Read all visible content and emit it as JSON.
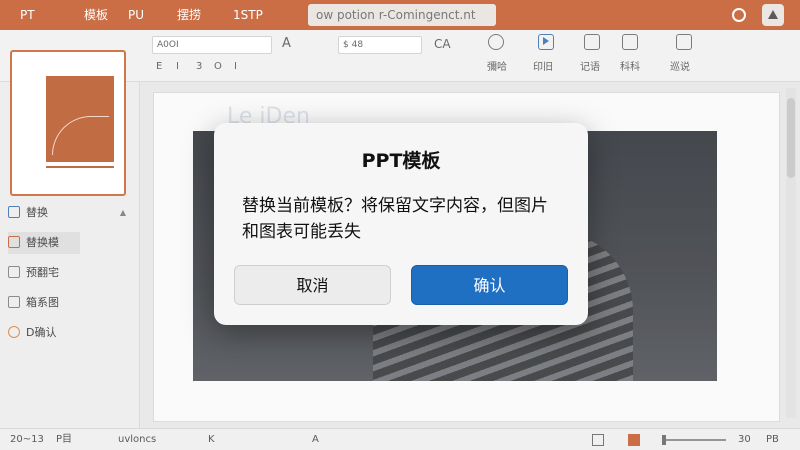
{
  "titlebar": {
    "app_label": "PT",
    "menu": [
      "模板",
      "PU",
      "摆捞",
      "1STP"
    ],
    "filename": "ow potion r-Comingenct.nt"
  },
  "ribbon": {
    "font_name": "A0OI",
    "font_size": "$ 48",
    "row1_labels": [
      "A",
      "CA"
    ],
    "row2_labels": [
      "E",
      "I",
      "3",
      "O",
      "I"
    ],
    "group_labels": [
      "彌哈",
      "印旧",
      "记语",
      "科科",
      "巡说"
    ]
  },
  "sidebar": {
    "items": [
      {
        "label": "替换",
        "icon": "layout-icon"
      },
      {
        "label": "替换模",
        "icon": "template-icon"
      },
      {
        "label": "预翻宅",
        "icon": "document-icon"
      },
      {
        "label": "箱系图",
        "icon": "chart-icon"
      },
      {
        "label": "D确认",
        "icon": "colors-icon"
      }
    ]
  },
  "slide": {
    "title_text": "Le iDen"
  },
  "statusbar": {
    "slide_count": "20~13",
    "view_label": "P目",
    "notes_label": "uvloncs",
    "mid_items": [
      "K",
      "A"
    ],
    "zoom_value": "30",
    "zoom_unit": "PB"
  },
  "dialog": {
    "title": "PPT模板",
    "message": "替换当前模板？将保留文字内容，但图片和图表可能丢失",
    "cancel_label": "取消",
    "confirm_label": "确认"
  },
  "colors": {
    "accent": "#c55a2c",
    "primary_button": "#1f6fc2"
  }
}
